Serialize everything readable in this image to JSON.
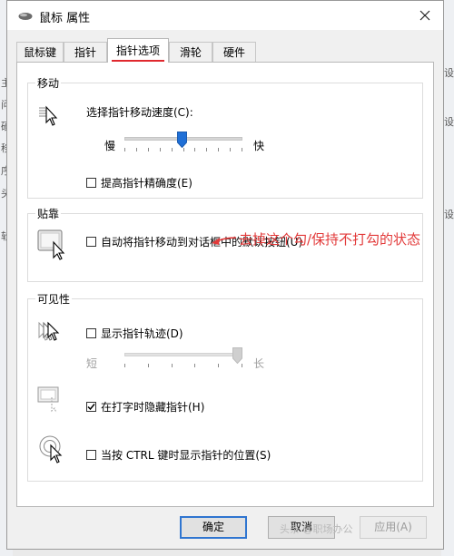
{
  "window": {
    "title": "鼠标 属性",
    "tabs": [
      {
        "label": "鼠标键"
      },
      {
        "label": "指针"
      },
      {
        "label": "指针选项"
      },
      {
        "label": "滑轮"
      },
      {
        "label": "硬件"
      }
    ],
    "active_tab": "指针选项"
  },
  "motion": {
    "title": "移动",
    "speed_label": "选择指针移动速度(C):",
    "slow_label": "慢",
    "fast_label": "快",
    "speed_fraction": 0.49,
    "precision_label": "提高指针精确度(E)",
    "precision_checked": false
  },
  "snap": {
    "title": "贴靠",
    "snap_label": "自动将指针移动到对话框中的默认按钮(U)",
    "snap_checked": false
  },
  "visibility": {
    "title": "可见性",
    "trails_label": "显示指针轨迹(D)",
    "trails_checked": false,
    "short_label": "短",
    "long_label": "长",
    "trails_fraction": 1.0,
    "hide_typing_label": "在打字时隐藏指针(H)",
    "hide_typing_checked": true,
    "ctrl_label": "当按 CTRL 键时显示指针的位置(S)",
    "ctrl_checked": false
  },
  "annotation": {
    "text": "去掉这个勾/保持不打勾的状态",
    "color": "#e23a3a"
  },
  "buttons": {
    "ok": "确定",
    "cancel": "取消",
    "apply": "应用(A)"
  },
  "background": {
    "left_chars": [
      "主",
      "问",
      "硬",
      "移",
      "序",
      "头",
      "软"
    ],
    "right_chars": [
      "设",
      "设",
      "设"
    ]
  },
  "watermark": "头条 @职场办公"
}
